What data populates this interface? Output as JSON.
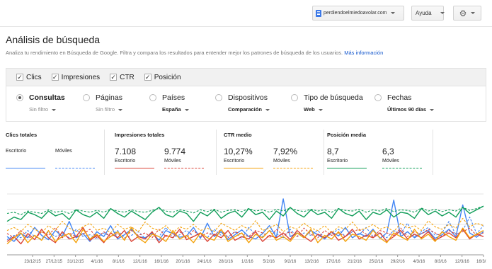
{
  "topbar": {
    "site": "perdiendoelmiedoavolar.com",
    "help": "Ayuda",
    "settings_icon": "gear-icon"
  },
  "page": {
    "title": "Análisis de búsqueda",
    "description": "Analiza tu rendimiento en Búsqueda de Google. Filtra y compara los resultados para entender mejor los patrones de búsqueda de los usuarios.",
    "more_info": "Más información"
  },
  "metrics": [
    {
      "label": "Clics",
      "checked": true
    },
    {
      "label": "Impresiones",
      "checked": true
    },
    {
      "label": "CTR",
      "checked": true
    },
    {
      "label": "Posición",
      "checked": true
    }
  ],
  "dimensions": [
    {
      "label": "Consultas",
      "filter": "Sin filtro",
      "selected": true
    },
    {
      "label": "Páginas",
      "filter": "Sin filtro",
      "selected": false
    },
    {
      "label": "Países",
      "filter": "España",
      "selected": false
    },
    {
      "label": "Dispositivos",
      "filter": "Comparación",
      "selected": false
    },
    {
      "label": "Tipo de búsqueda",
      "filter": "Web",
      "selected": false
    },
    {
      "label": "Fechas",
      "filter": "Últimos 90 días",
      "selected": false
    }
  ],
  "summary": [
    {
      "title": "Clics totales",
      "a_value": "",
      "a_label": "Escritorio",
      "b_value": "",
      "b_label": "Móviles",
      "color": "#4285f4"
    },
    {
      "title": "Impresiones totales",
      "a_value": "7.108",
      "a_label": "Escritorio",
      "b_value": "9.774",
      "b_label": "Móviles",
      "color": "#db4437"
    },
    {
      "title": "CTR medio",
      "a_value": "10,27%",
      "a_label": "Escritorio",
      "b_value": "7,92%",
      "b_label": "Móviles",
      "color": "#f4a20b"
    },
    {
      "title": "Posición media",
      "a_value": "8,7",
      "a_label": "Escritorio",
      "b_value": "6,3",
      "b_label": "Móviles",
      "color": "#0f9d58"
    }
  ],
  "chart_data": {
    "type": "line",
    "x_tick_labels": [
      "23/12/15",
      "27/12/15",
      "31/12/15",
      "4/1/16",
      "8/1/16",
      "12/1/16",
      "16/1/16",
      "20/1/16",
      "24/1/16",
      "28/1/16",
      "1/2/16",
      "5/2/16",
      "9/2/16",
      "13/2/16",
      "17/2/16",
      "21/2/16",
      "25/2/16",
      "29/2/16",
      "4/3/16",
      "8/3/16",
      "12/3/16",
      "16/3/16"
    ],
    "series": [
      {
        "name": "Clics Escritorio",
        "color": "#4285f4",
        "dashed": false,
        "values": [
          0.3,
          0.22,
          0.35,
          0.28,
          0.45,
          0.32,
          0.25,
          0.4,
          0.3,
          0.55,
          0.28,
          0.35,
          0.22,
          0.38,
          0.3,
          0.48,
          0.26,
          0.33,
          0.42,
          0.3,
          0.28,
          0.36,
          0.24,
          0.4,
          0.35,
          0.29,
          0.31,
          0.45,
          0.27,
          0.52,
          0.3,
          0.38,
          0.25,
          0.33,
          0.41,
          0.3,
          0.26,
          0.35,
          0.48,
          0.29,
          0.92,
          0.3,
          0.36,
          0.28,
          0.4,
          0.33,
          0.26,
          0.38,
          0.31,
          0.45,
          0.28,
          0.35,
          0.3,
          0.42,
          0.27,
          0.36,
          0.9,
          0.3,
          0.38,
          0.28,
          0.35,
          0.4,
          0.27,
          0.33,
          0.42,
          0.3,
          0.82,
          0.36,
          0.29,
          0.38
        ]
      },
      {
        "name": "Clics Móviles",
        "color": "#4285f4",
        "dashed": true,
        "values": [
          0.25,
          0.32,
          0.28,
          0.4,
          0.3,
          0.26,
          0.38,
          0.3,
          0.35,
          0.28,
          0.42,
          0.3,
          0.33,
          0.26,
          0.36,
          0.3,
          0.4,
          0.28,
          0.32,
          0.38,
          0.27,
          0.35,
          0.3,
          0.45,
          0.28,
          0.33,
          0.4,
          0.3,
          0.36,
          0.28,
          0.42,
          0.32,
          0.3,
          0.38,
          0.27,
          0.45,
          0.33,
          0.3,
          0.4,
          0.35,
          0.28,
          0.42,
          0.3,
          0.36,
          0.32,
          0.4,
          0.28,
          0.35,
          0.42,
          0.3,
          0.38,
          0.33,
          0.45,
          0.3,
          0.36,
          0.28,
          0.4,
          0.35,
          0.52,
          0.3,
          0.38,
          0.45,
          0.32,
          0.36,
          0.55,
          0.33,
          0.4,
          0.62,
          0.35,
          0.48
        ]
      },
      {
        "name": "Impresiones Escritorio",
        "color": "#db4437",
        "dashed": false,
        "values": [
          0.22,
          0.3,
          0.18,
          0.35,
          0.25,
          0.42,
          0.28,
          0.2,
          0.38,
          0.26,
          0.3,
          0.45,
          0.24,
          0.32,
          0.2,
          0.36,
          0.28,
          0.4,
          0.22,
          0.3,
          0.26,
          0.38,
          0.2,
          0.32,
          0.28,
          0.42,
          0.25,
          0.3,
          0.36,
          0.22,
          0.34,
          0.28,
          0.4,
          0.24,
          0.3,
          0.26,
          0.38,
          0.22,
          0.32,
          0.28,
          0.36,
          0.25,
          0.4,
          0.3,
          0.22,
          0.34,
          0.28,
          0.38,
          0.24,
          0.3,
          0.42,
          0.26,
          0.32,
          0.28,
          0.36,
          0.22,
          0.3,
          0.4,
          0.26,
          0.34,
          0.28,
          0.38,
          0.24,
          0.3,
          0.36,
          0.28,
          0.42,
          0.26,
          0.34,
          0.3
        ]
      },
      {
        "name": "Impresiones Móviles",
        "color": "#db4437",
        "dashed": true,
        "values": [
          0.35,
          0.28,
          0.4,
          0.3,
          0.26,
          0.38,
          0.32,
          0.45,
          0.28,
          0.36,
          0.3,
          0.34,
          0.42,
          0.28,
          0.38,
          0.3,
          0.35,
          0.26,
          0.4,
          0.32,
          0.36,
          0.28,
          0.42,
          0.3,
          0.34,
          0.38,
          0.28,
          0.4,
          0.3,
          0.36,
          0.32,
          0.42,
          0.28,
          0.38,
          0.34,
          0.3,
          0.4,
          0.36,
          0.28,
          0.42,
          0.32,
          0.38,
          0.3,
          0.44,
          0.34,
          0.28,
          0.4,
          0.32,
          0.36,
          0.3,
          0.38,
          0.42,
          0.34,
          0.3,
          0.4,
          0.36,
          0.32,
          0.44,
          0.3,
          0.38,
          0.34,
          0.42,
          0.36,
          0.3,
          0.4,
          0.34,
          0.38,
          0.44,
          0.32,
          0.36
        ]
      },
      {
        "name": "CTR Escritorio",
        "color": "#f4a20b",
        "dashed": false,
        "values": [
          0.18,
          0.28,
          0.36,
          0.2,
          0.32,
          0.24,
          0.4,
          0.22,
          0.3,
          0.35,
          0.2,
          0.42,
          0.26,
          0.34,
          0.22,
          0.3,
          0.38,
          0.24,
          0.45,
          0.28,
          0.2,
          0.34,
          0.3,
          0.22,
          0.4,
          0.26,
          0.32,
          0.2,
          0.36,
          0.28,
          0.24,
          0.42,
          0.22,
          0.3,
          0.36,
          0.2,
          0.34,
          0.28,
          0.4,
          0.24,
          0.3,
          0.22,
          0.36,
          0.28,
          0.42,
          0.2,
          0.32,
          0.26,
          0.38,
          0.22,
          0.34,
          0.3,
          0.24,
          0.4,
          0.28,
          0.2,
          0.36,
          0.3,
          0.24,
          0.42,
          0.26,
          0.34,
          0.22,
          0.38,
          0.3,
          0.24,
          0.44,
          0.28,
          0.34,
          0.4
        ]
      },
      {
        "name": "CTR Móviles",
        "color": "#f4a20b",
        "dashed": true,
        "values": [
          0.4,
          0.45,
          0.38,
          0.5,
          0.42,
          0.36,
          0.48,
          0.4,
          0.55,
          0.44,
          0.38,
          0.46,
          0.52,
          0.4,
          0.44,
          0.36,
          0.5,
          0.42,
          0.46,
          0.38,
          0.54,
          0.44,
          0.4,
          0.48,
          0.36,
          0.46,
          0.42,
          0.5,
          0.4,
          0.44,
          0.38,
          0.52,
          0.46,
          0.4,
          0.48,
          0.42,
          0.56,
          0.4,
          0.44,
          0.5,
          0.38,
          0.46,
          0.42,
          0.52,
          0.44,
          0.4,
          0.48,
          0.36,
          0.46,
          0.42,
          0.54,
          0.4,
          0.44,
          0.5,
          0.42,
          0.46,
          0.38,
          0.52,
          0.44,
          0.48,
          0.4,
          0.56,
          0.46,
          0.42,
          0.5,
          0.44,
          0.6,
          0.46,
          0.52,
          0.48
        ]
      },
      {
        "name": "Posición Escritorio",
        "color": "#0f9d58",
        "dashed": false,
        "values": [
          0.55,
          0.62,
          0.58,
          0.7,
          0.66,
          0.6,
          0.72,
          0.64,
          0.68,
          0.58,
          0.74,
          0.66,
          0.62,
          0.7,
          0.6,
          0.76,
          0.68,
          0.62,
          0.72,
          0.65,
          0.58,
          0.7,
          0.78,
          0.66,
          0.62,
          0.72,
          0.68,
          0.55,
          0.7,
          0.64,
          0.74,
          0.6,
          0.68,
          0.72,
          0.62,
          0.76,
          0.66,
          0.7,
          0.58,
          0.72,
          0.64,
          0.78,
          0.68,
          0.62,
          0.74,
          0.66,
          0.7,
          0.6,
          0.76,
          0.68,
          0.64,
          0.72,
          0.58,
          0.7,
          0.66,
          0.74,
          0.62,
          0.7,
          0.68,
          0.6,
          0.76,
          0.66,
          0.72,
          0.64,
          0.7,
          0.62,
          0.78,
          0.68,
          0.74,
          0.8
        ]
      },
      {
        "name": "Posición Móviles",
        "color": "#0f9d58",
        "dashed": true,
        "values": [
          0.68,
          0.7,
          0.66,
          0.72,
          0.7,
          0.68,
          0.74,
          0.7,
          0.72,
          0.68,
          0.74,
          0.72,
          0.7,
          0.73,
          0.7,
          0.75,
          0.72,
          0.7,
          0.74,
          0.71,
          0.7,
          0.73,
          0.76,
          0.72,
          0.7,
          0.74,
          0.72,
          0.69,
          0.74,
          0.71,
          0.75,
          0.7,
          0.73,
          0.74,
          0.71,
          0.76,
          0.72,
          0.74,
          0.7,
          0.75,
          0.72,
          0.77,
          0.73,
          0.71,
          0.75,
          0.72,
          0.74,
          0.7,
          0.76,
          0.73,
          0.72,
          0.75,
          0.7,
          0.74,
          0.72,
          0.76,
          0.71,
          0.74,
          0.73,
          0.7,
          0.77,
          0.72,
          0.75,
          0.71,
          0.74,
          0.72,
          0.78,
          0.73,
          0.76,
          0.8
        ]
      }
    ],
    "ylim": [
      0,
      1
    ],
    "grid": true
  }
}
